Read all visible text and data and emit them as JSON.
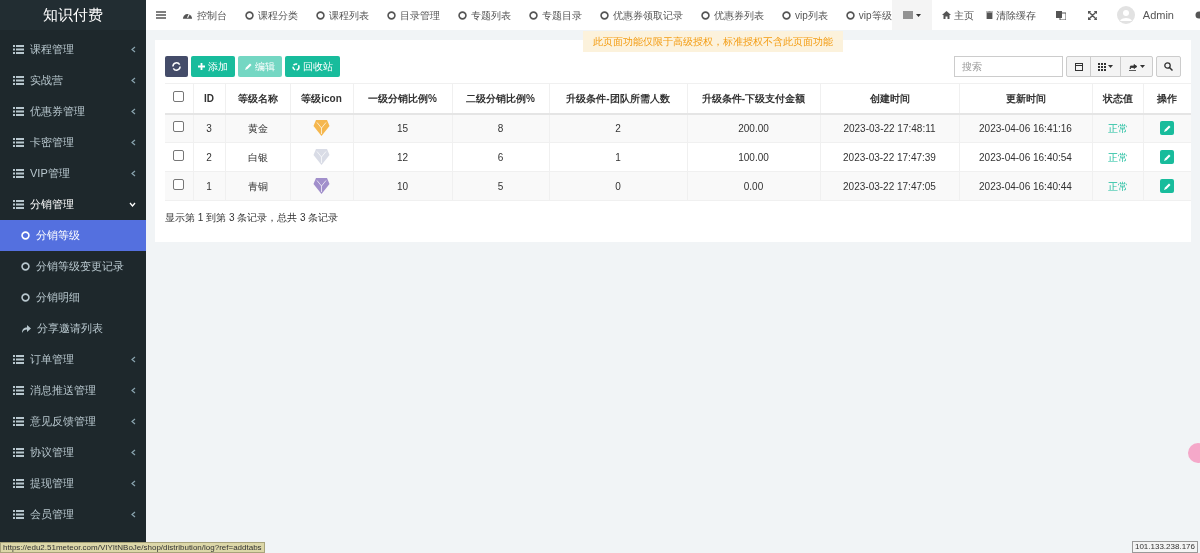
{
  "sidebar": {
    "logo": "知识付费",
    "items": [
      {
        "label": "课程管理",
        "expanded": false
      },
      {
        "label": "实战营",
        "expanded": false
      },
      {
        "label": "优惠券管理",
        "expanded": false
      },
      {
        "label": "卡密管理",
        "expanded": false
      },
      {
        "label": "VIP管理",
        "expanded": false
      },
      {
        "label": "分销管理",
        "expanded": true,
        "children": [
          {
            "label": "分销等级",
            "kind": "circle",
            "selected": true
          },
          {
            "label": "分销等级变更记录",
            "kind": "circle",
            "selected": false
          },
          {
            "label": "分销明细",
            "kind": "circle",
            "selected": false
          },
          {
            "label": "分享邀请列表",
            "kind": "share",
            "selected": false
          }
        ]
      },
      {
        "label": "订单管理",
        "expanded": false
      },
      {
        "label": "消息推送管理",
        "expanded": false
      },
      {
        "label": "意见反馈管理",
        "expanded": false
      },
      {
        "label": "协议管理",
        "expanded": false
      },
      {
        "label": "提现管理",
        "expanded": false
      },
      {
        "label": "会员管理",
        "expanded": false
      }
    ]
  },
  "topbar": {
    "tabs": [
      {
        "label": "控制台",
        "kind": "dashboard"
      },
      {
        "label": "课程分类",
        "kind": "circle"
      },
      {
        "label": "课程列表",
        "kind": "circle"
      },
      {
        "label": "目录管理",
        "kind": "circle"
      },
      {
        "label": "专题列表",
        "kind": "circle"
      },
      {
        "label": "专题目录",
        "kind": "circle"
      },
      {
        "label": "优惠券领取记录",
        "kind": "circle"
      },
      {
        "label": "优惠券列表",
        "kind": "circle"
      },
      {
        "label": "vip列表",
        "kind": "circle"
      },
      {
        "label": "vip等级",
        "kind": "circle"
      }
    ],
    "home": "主页",
    "clear_cache": "清除缓存",
    "user": "Admin"
  },
  "notice": "此页面功能仅限于高级授权，标准授权不含此页面功能",
  "toolbar": {
    "add": "添加",
    "edit": "编辑",
    "edit_disabled": true,
    "recycle": "回收站",
    "search_placeholder": "搜索"
  },
  "table": {
    "header_checked": false,
    "columns": [
      "ID",
      "等级名称",
      "等级icon",
      "一级分销比例%",
      "二级分销比例%",
      "升级条件-团队所需人数",
      "升级条件-下级支付金额",
      "创建时间",
      "更新时间",
      "状态值",
      "操作"
    ],
    "rows": [
      {
        "checked": false,
        "id": "3",
        "name": "黄金",
        "color": "#f5b74e",
        "level1": "15",
        "level2": "8",
        "team": "2",
        "amount": "200.00",
        "created": "2023-03-22 17:48:11",
        "updated": "2023-04-06 16:41:16",
        "status": "正常"
      },
      {
        "checked": false,
        "id": "2",
        "name": "白银",
        "color": "#d9dce6",
        "level1": "12",
        "level2": "6",
        "team": "1",
        "amount": "100.00",
        "created": "2023-03-22 17:47:39",
        "updated": "2023-04-06 16:40:54",
        "status": "正常"
      },
      {
        "checked": false,
        "id": "1",
        "name": "青铜",
        "color": "#a18fcb",
        "level1": "10",
        "level2": "5",
        "team": "0",
        "amount": "0.00",
        "created": "2023-03-22 17:47:05",
        "updated": "2023-04-06 16:40:44",
        "status": "正常"
      }
    ]
  },
  "summary": "显示第 1 到第 3 条记录，总共 3 条记录",
  "status_url": "https://edu2.51meteor.com/VIYItNBoJe/shop/distribution/log?ref=addtabs",
  "ip": "101.133.238.176"
}
